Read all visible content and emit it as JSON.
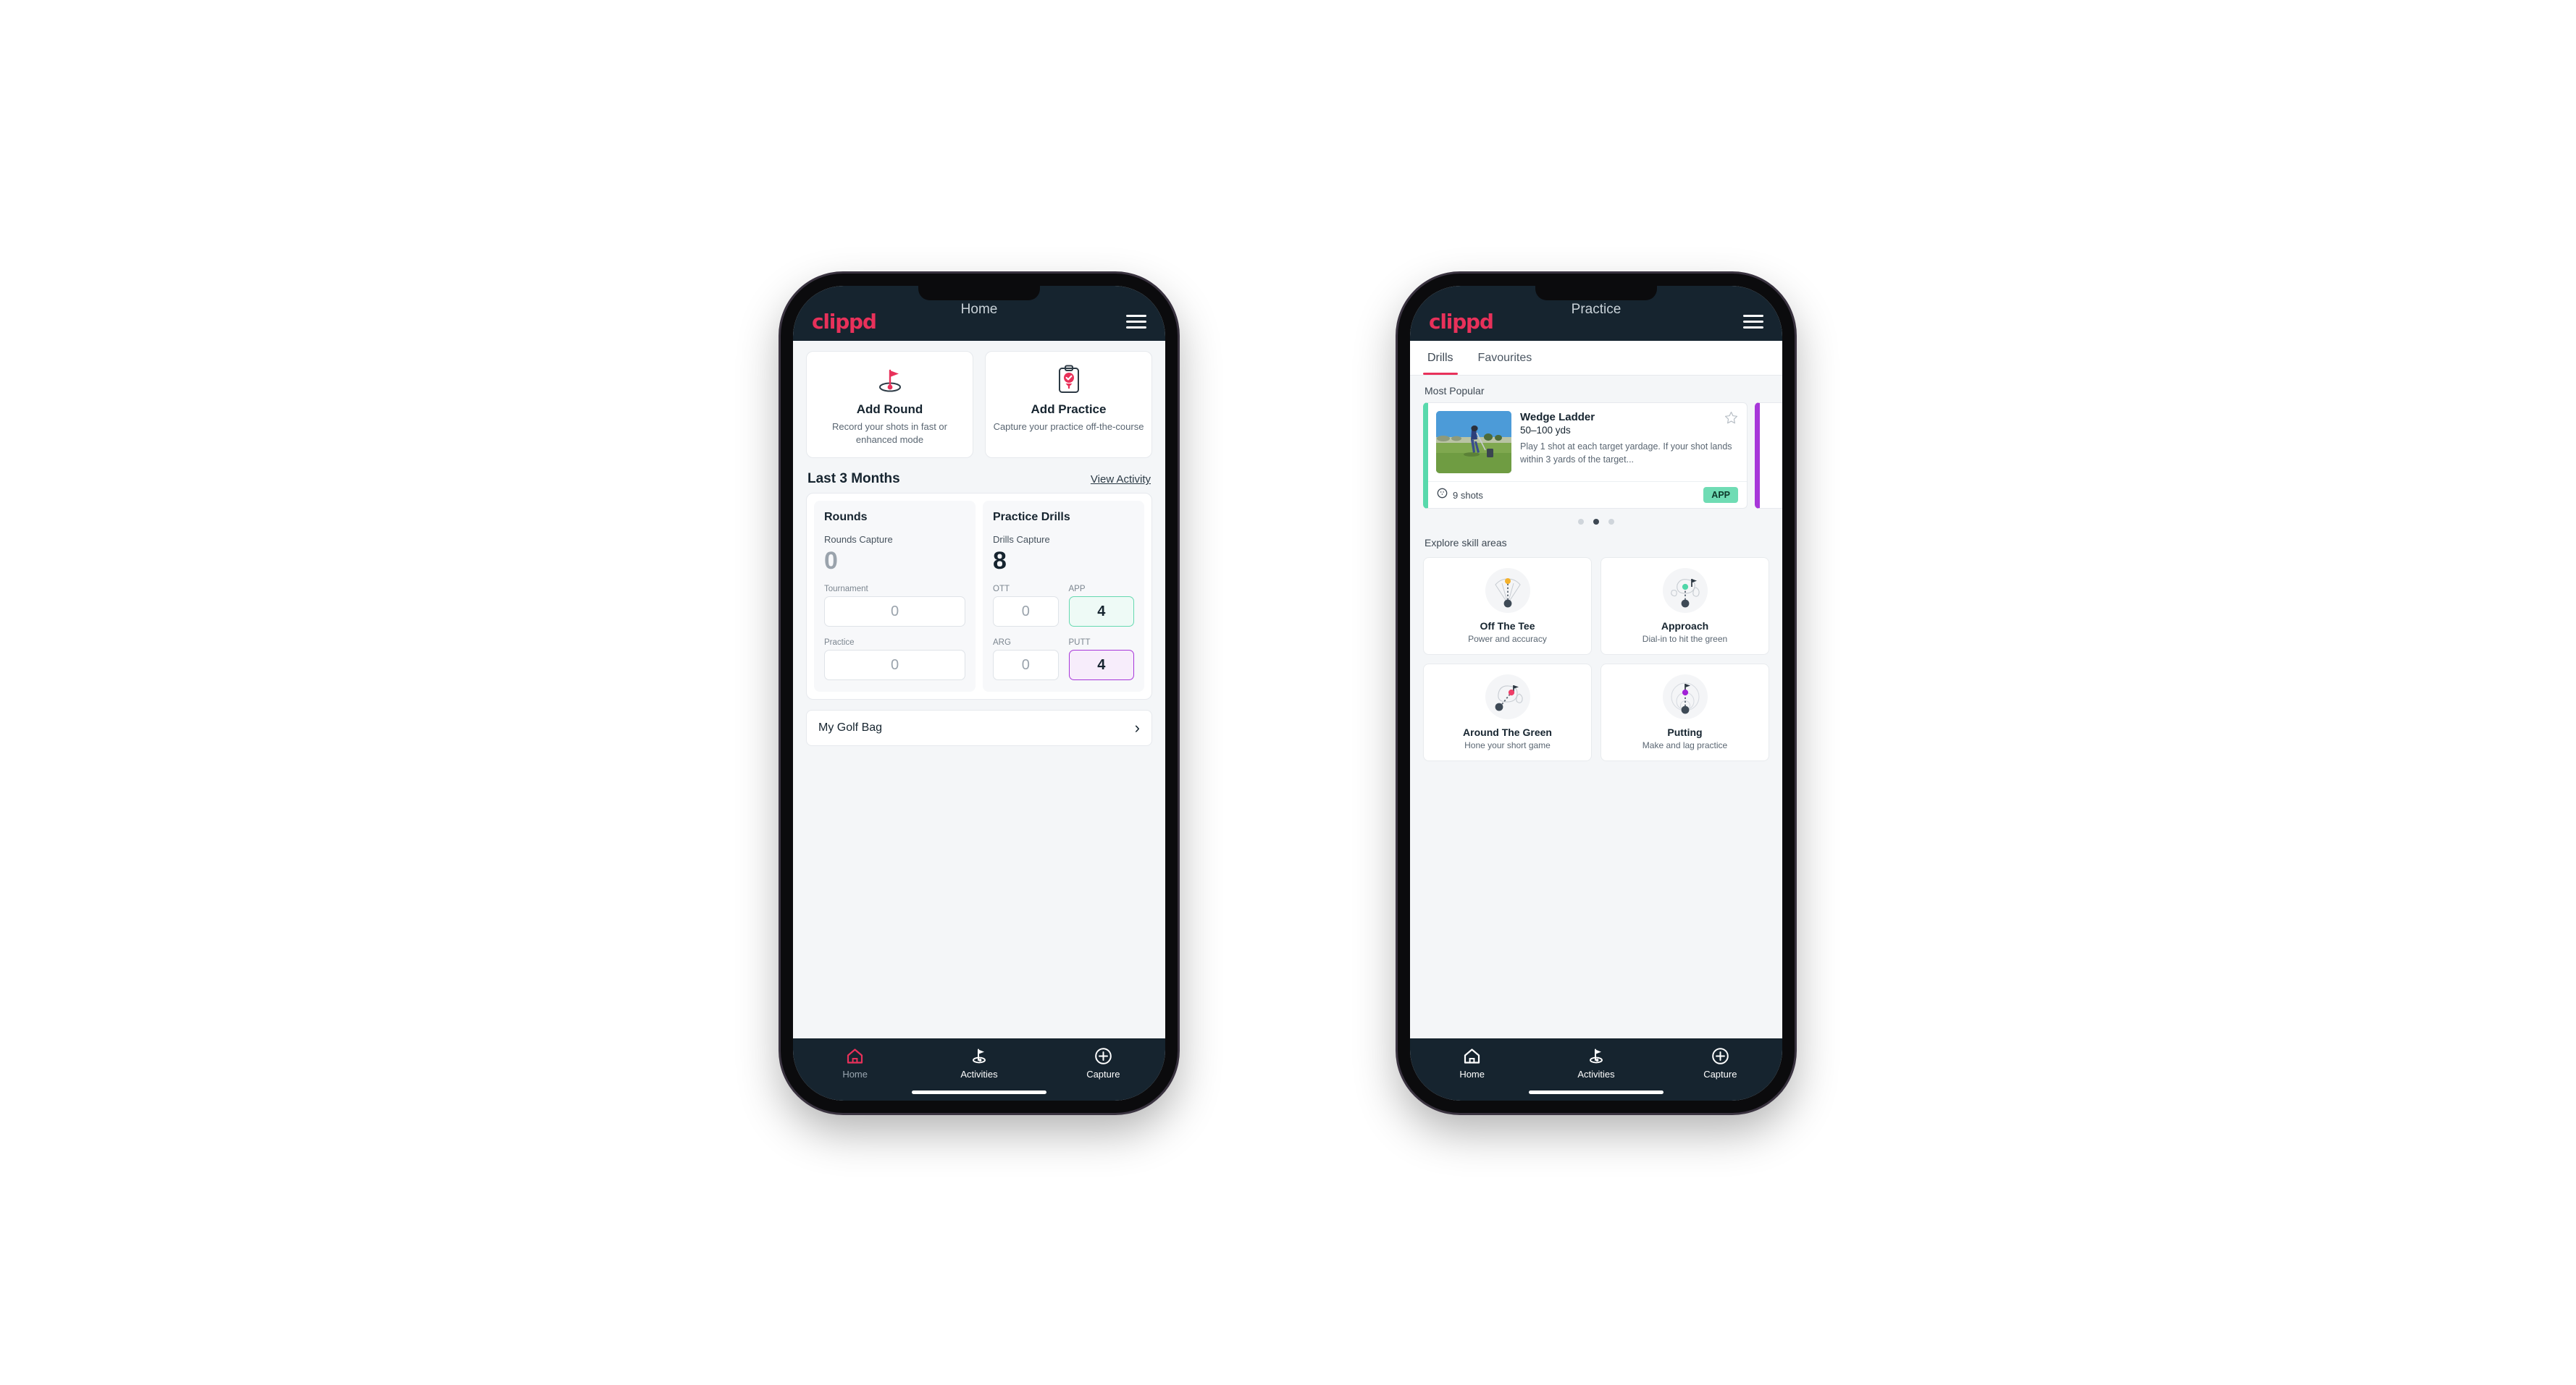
{
  "phones": {
    "home": {
      "appbar": {
        "brand": "clippd",
        "title": "Home",
        "menu_icon": "hamburger-icon"
      },
      "actions": [
        {
          "icon": "golf-flag-hole-icon",
          "title": "Add Round",
          "subtitle": "Record your shots in fast or enhanced mode"
        },
        {
          "icon": "clipboard-check-icon",
          "title": "Add Practice",
          "subtitle": "Capture your practice off-the-course"
        }
      ],
      "section": {
        "title": "Last 3 Months",
        "link": "View Activity"
      },
      "stats": {
        "rounds": {
          "title": "Rounds",
          "capture_label": "Rounds Capture",
          "capture_value": "0",
          "fields": [
            {
              "label": "Tournament",
              "value": "0",
              "accent": "none"
            },
            {
              "label": "Practice",
              "value": "0",
              "accent": "none"
            }
          ]
        },
        "drills": {
          "title": "Practice Drills",
          "capture_label": "Drills Capture",
          "capture_value": "8",
          "fields": [
            {
              "label": "OTT",
              "value": "0",
              "accent": "none"
            },
            {
              "label": "APP",
              "value": "4",
              "accent": "green"
            },
            {
              "label": "ARG",
              "value": "0",
              "accent": "none"
            },
            {
              "label": "PUTT",
              "value": "4",
              "accent": "purple"
            }
          ]
        }
      },
      "golf_bag": {
        "label": "My Golf Bag",
        "chevron": "chevron-right-icon"
      },
      "nav": [
        {
          "icon": "home-icon",
          "label": "Home",
          "active": true
        },
        {
          "icon": "golf-flag-icon",
          "label": "Activities",
          "active": false
        },
        {
          "icon": "plus-circle-icon",
          "label": "Capture",
          "active": false
        }
      ]
    },
    "practice": {
      "appbar": {
        "brand": "clippd",
        "title": "Practice",
        "menu_icon": "hamburger-icon"
      },
      "tabs": [
        {
          "label": "Drills",
          "active": true
        },
        {
          "label": "Favourites",
          "active": false
        }
      ],
      "most_popular_label": "Most Popular",
      "drills": [
        {
          "title": "Wedge Ladder",
          "range": "50–100 yds",
          "description": "Play 1 shot at each target yardage. If your shot lands within 3 yards of the target...",
          "shots": "9 shots",
          "shots_icon": "golf-ball-icon",
          "chip": "APP",
          "chip_color": "#6fdcb4",
          "accent_color": "#58d9ac",
          "star_icon": "star-outline-icon"
        }
      ],
      "peek_accent_color": "#a737d9",
      "carousel_dots": {
        "count": 3,
        "active_index": 1
      },
      "explore_label": "Explore skill areas",
      "skills": [
        {
          "icon": "tee-dispersion-icon",
          "name": "Off The Tee",
          "subtitle": "Power and accuracy",
          "dot_color": "#f4b12c"
        },
        {
          "icon": "green-approach-icon",
          "name": "Approach",
          "subtitle": "Dial-in to hit the green",
          "dot_color": "#4fd6a8"
        },
        {
          "icon": "chip-around-green-icon",
          "name": "Around The Green",
          "subtitle": "Hone your short game",
          "dot_color": "#ef3f68"
        },
        {
          "icon": "putting-rings-icon",
          "name": "Putting",
          "subtitle": "Make and lag practice",
          "dot_color": "#a222d6"
        }
      ],
      "nav": [
        {
          "icon": "home-icon",
          "label": "Home",
          "active": false
        },
        {
          "icon": "golf-flag-icon",
          "label": "Activities",
          "active": false
        },
        {
          "icon": "plus-circle-icon",
          "label": "Capture",
          "active": false
        }
      ]
    }
  }
}
